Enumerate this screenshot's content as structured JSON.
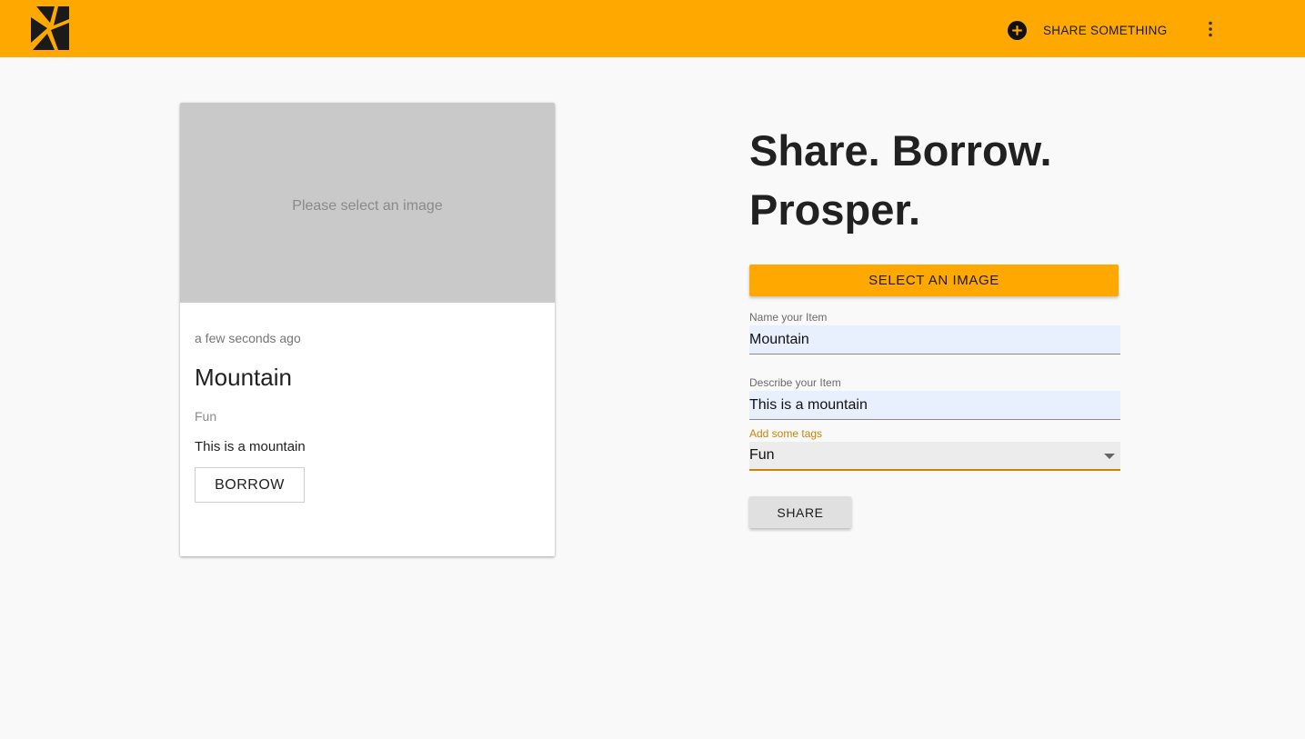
{
  "topbar": {
    "logo_icon": "boomtown-logo-icon",
    "share_something_label": "SHARE SOMETHING",
    "share_something_icon": "plus-circle-icon",
    "more_icon": "more-vert-icon",
    "accent_color": "#ffa900"
  },
  "preview_card": {
    "image_placeholder": "Please select an image",
    "timestamp": "a few seconds ago",
    "title": "Mountain",
    "tag": "Fun",
    "description": "This is a mountain",
    "borrow_label": "BORROW"
  },
  "form": {
    "headline": "Share. Borrow. Prosper.",
    "select_image_label": "SELECT AN IMAGE",
    "name_label": "Name your Item",
    "name_value": "Mountain",
    "description_label": "Describe your Item",
    "description_value": "This is a mountain",
    "tags_label": "Add some tags",
    "tags_value": "Fun",
    "tags_icon": "caret-down-icon",
    "share_label": "SHARE"
  }
}
